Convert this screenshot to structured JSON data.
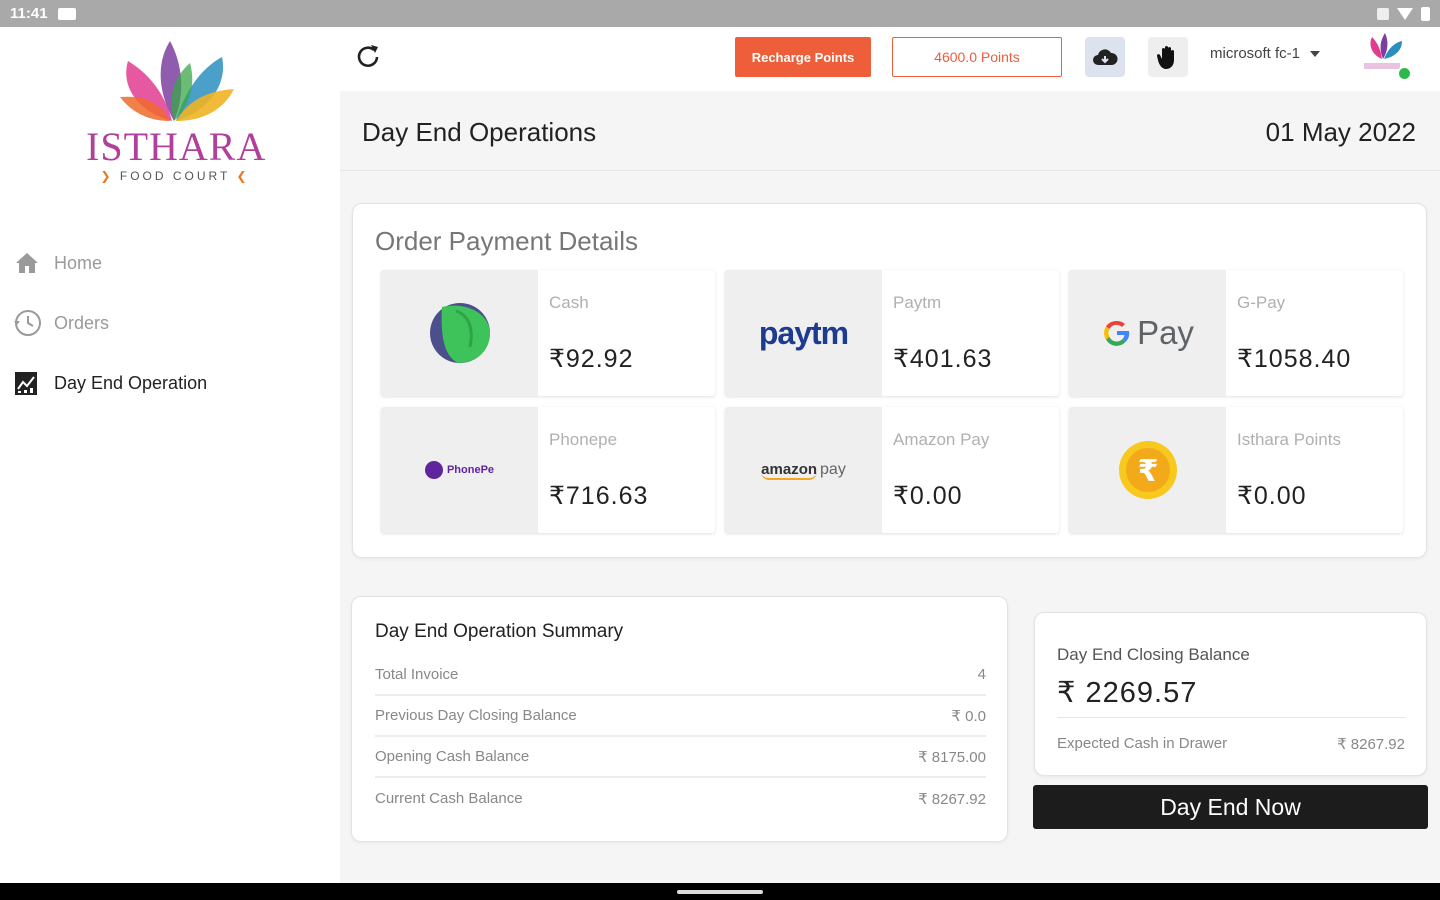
{
  "status_bar": {
    "time": "11:41"
  },
  "sidebar": {
    "brand": {
      "name": "ISTHARA",
      "tagline": "FOOD COURT"
    },
    "items": [
      {
        "label": "Home",
        "icon": "home-icon",
        "active": false
      },
      {
        "label": "Orders",
        "icon": "history-icon",
        "active": false
      },
      {
        "label": "Day End Operation",
        "icon": "chart-report-icon",
        "active": true
      }
    ]
  },
  "topbar": {
    "recharge_label": "Recharge Points",
    "points_label": "4600.0 Points",
    "user_name": "microsoft fc-1",
    "online_color": "#2db84d"
  },
  "header": {
    "title": "Day End Operations",
    "date": "01 May 2022"
  },
  "payments": {
    "title": "Order Payment Details",
    "tiles": [
      {
        "label": "Cash",
        "amount": "₹92.92",
        "icon": "cash-icon"
      },
      {
        "label": "Paytm",
        "amount": "₹401.63",
        "icon": "paytm-logo"
      },
      {
        "label": "G-Pay",
        "amount": "₹1058.40",
        "icon": "gpay-logo"
      },
      {
        "label": "Phonepe",
        "amount": "₹716.63",
        "icon": "phonepe-logo"
      },
      {
        "label": "Amazon Pay",
        "amount": "₹0.00",
        "icon": "amazon-pay-logo"
      },
      {
        "label": "Isthara Points",
        "amount": "₹0.00",
        "icon": "coin-icon"
      }
    ],
    "logo_text": {
      "paytm": "paytm",
      "gpay": "Pay",
      "phonepe": "PhonePe",
      "amazon": "amazon",
      "amazon_pay": "pay"
    }
  },
  "summary": {
    "title": "Day End Operation Summary",
    "rows": [
      {
        "label": "Total Invoice",
        "value": "4"
      },
      {
        "label": "Previous Day Closing Balance",
        "value": "₹ 0.0"
      },
      {
        "label": "Opening Cash Balance",
        "value": "₹ 8175.00"
      },
      {
        "label": "Current Cash Balance",
        "value": "₹ 8267.92"
      }
    ]
  },
  "closing": {
    "label": "Day End Closing Balance",
    "value": "₹ 2269.57",
    "expected_label": "Expected Cash in Drawer",
    "expected_value": "₹ 8267.92"
  },
  "actions": {
    "day_end_label": "Day End Now"
  },
  "colors": {
    "accent": "#ee5e3a",
    "dark_button": "#1c1c1c"
  }
}
